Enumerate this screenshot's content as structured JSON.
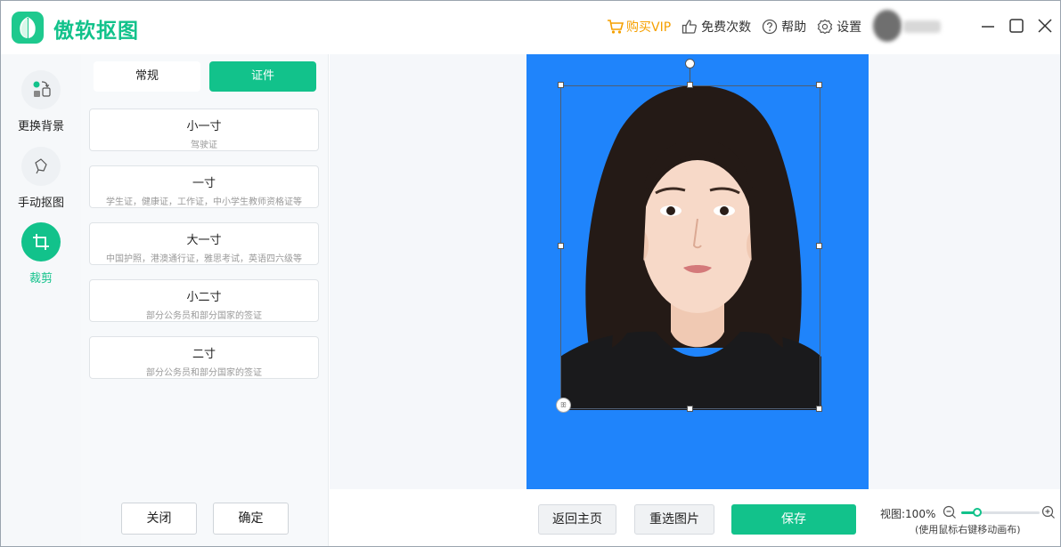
{
  "app": {
    "title": "傲软抠图"
  },
  "header": {
    "actions": [
      {
        "label": "购买VIP",
        "icon": "cart-icon"
      },
      {
        "label": "免费次数",
        "icon": "thumbs-up-icon"
      },
      {
        "label": "帮助",
        "icon": "help-icon"
      },
      {
        "label": "设置",
        "icon": "gear-icon"
      }
    ]
  },
  "nav": {
    "items": [
      {
        "label": "更换背景",
        "icon": "swap-background-icon"
      },
      {
        "label": "手动抠图",
        "icon": "lasso-icon"
      },
      {
        "label": "裁剪",
        "icon": "crop-icon",
        "active": true
      }
    ]
  },
  "panel": {
    "tabs": [
      {
        "label": "常规"
      },
      {
        "label": "证件",
        "active": true
      }
    ],
    "sizes": [
      {
        "name": "小一寸",
        "desc": "驾驶证"
      },
      {
        "name": "一寸",
        "desc": "学生证，健康证，工作证，中小学生教师资格证等"
      },
      {
        "name": "大一寸",
        "desc": "中国护照，港澳通行证，雅思考试，英语四六级等"
      },
      {
        "name": "小二寸",
        "desc": "部分公务员和部分国家的签证"
      },
      {
        "name": "二寸",
        "desc": "部分公务员和部分国家的签证"
      }
    ],
    "close_label": "关闭",
    "confirm_label": "确定"
  },
  "canvas": {
    "background_color": "#1f84fb",
    "corner_badge": "ꕥ"
  },
  "bottom": {
    "home_label": "返回主页",
    "reselect_label": "重选图片",
    "save_label": "保存",
    "zoom_label": "视图:100%",
    "zoom_hint": "(使用鼠标右键移动画布)",
    "zoom_fraction": 0.2
  },
  "colors": {
    "accent": "#12c28b",
    "vip": "#f5a000",
    "photo_bg": "#1f84fb"
  }
}
